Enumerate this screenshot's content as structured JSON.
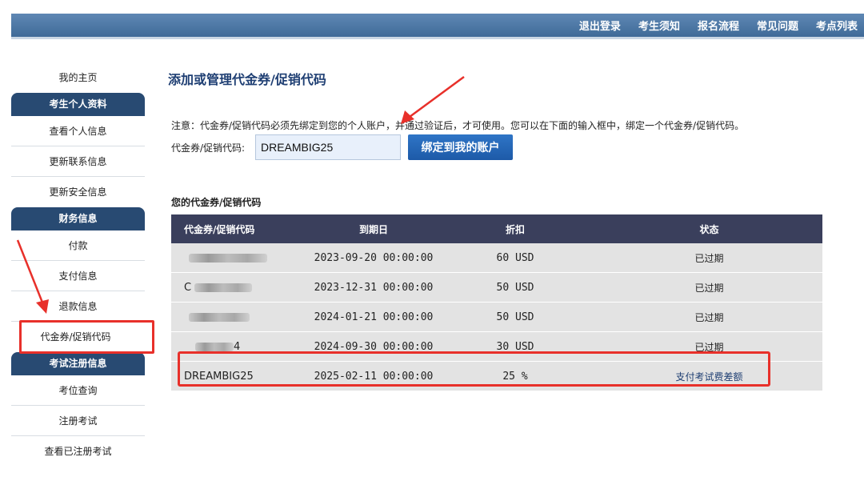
{
  "topnav": [
    "退出登录",
    "考生须知",
    "报名流程",
    "常见问题",
    "考点列表"
  ],
  "sidebar": {
    "home": "我的主页",
    "profile_header": "考生个人资料",
    "view_info": "查看个人信息",
    "update_contact": "更新联系信息",
    "update_security": "更新安全信息",
    "finance_header": "财务信息",
    "payment": "付款",
    "payment_info": "支付信息",
    "refund_info": "退款信息",
    "voucher": "代金券/促销代码",
    "exam_header": "考试注册信息",
    "seat_search": "考位查询",
    "register_exam": "注册考试",
    "view_registered": "查看已注册考试"
  },
  "main": {
    "title": "添加或管理代金券/促销代码",
    "notice": "注意：代金券/促销代码必须先绑定到您的个人账户，并通过验证后，才可使用。您可以在下面的输入框中，绑定一个代金券/促销代码。",
    "code_label": "代金券/促销代码:",
    "code_value": "DREAMBIG25",
    "bind_button": "绑定到我的账户",
    "table_title": "您的代金券/促销代码"
  },
  "table": {
    "headers": [
      "代金券/促销代码",
      "到期日",
      "折扣",
      "状态"
    ],
    "rows": [
      {
        "code": "",
        "expiry": "2023-09-20 00:00:00",
        "discount": "60 USD",
        "status": "已过期"
      },
      {
        "code": "C",
        "expiry": "2023-12-31 00:00:00",
        "discount": "50 USD",
        "status": "已过期"
      },
      {
        "code": "",
        "expiry": "2024-01-21 00:00:00",
        "discount": "50 USD",
        "status": "已过期"
      },
      {
        "code": "4",
        "expiry": "2024-09-30 00:00:00",
        "discount": "30 USD",
        "status": "已过期"
      },
      {
        "code": "DREAMBIG25",
        "expiry": "2025-02-11 00:00:00",
        "discount": "25 %",
        "status": "支付考试费差额"
      }
    ]
  },
  "colors": {
    "topbar": "#4f79a6",
    "sidebar_header": "#284a72",
    "table_header": "#3a3f5c",
    "button": "#2466b5",
    "annotation": "#e8302a"
  }
}
